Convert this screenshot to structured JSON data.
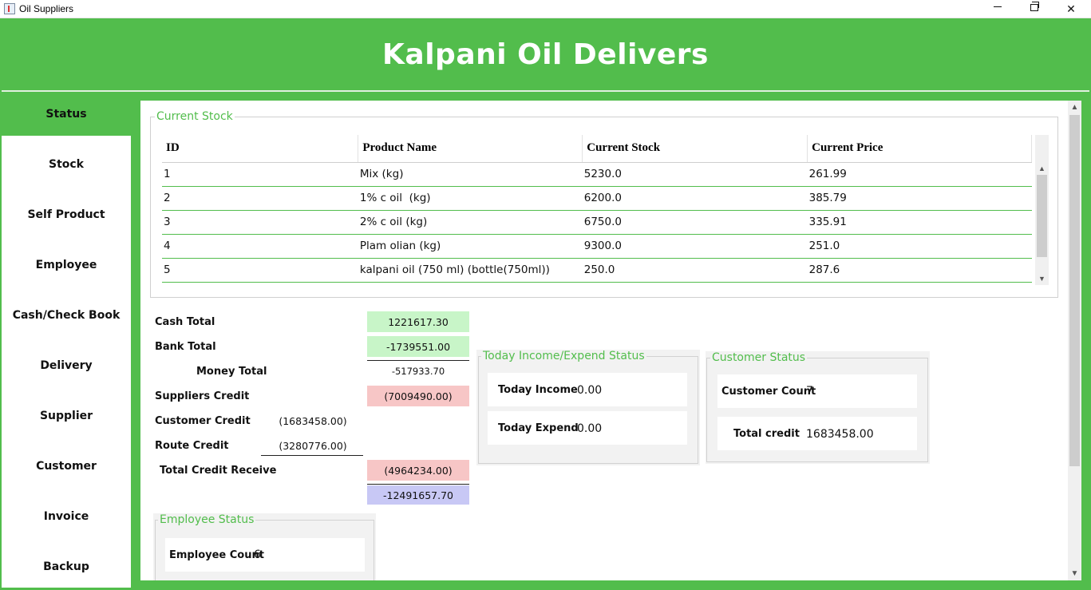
{
  "window": {
    "title": "Oil Suppliers"
  },
  "header": {
    "title": "Kalpani Oil Delivers"
  },
  "sidebar": {
    "items": [
      {
        "label": "Status"
      },
      {
        "label": "Stock"
      },
      {
        "label": "Self Product"
      },
      {
        "label": "Employee"
      },
      {
        "label": "Cash/Check Book"
      },
      {
        "label": "Delivery"
      },
      {
        "label": "Supplier"
      },
      {
        "label": "Customer"
      },
      {
        "label": "Invoice"
      },
      {
        "label": "Backup"
      }
    ],
    "active": "Status"
  },
  "stock": {
    "title": "Current Stock",
    "columns": [
      "ID",
      "Product Name",
      "Current Stock",
      "Current Price"
    ],
    "rows": [
      [
        "1",
        "Mix (kg)",
        "5230.0",
        "261.99"
      ],
      [
        "2",
        "1% c oil  (kg)",
        "6200.0",
        "385.79"
      ],
      [
        "3",
        "2% c oil (kg)",
        "6750.0",
        "335.91"
      ],
      [
        "4",
        "Plam olian (kg)",
        "9300.0",
        "251.0"
      ],
      [
        "5",
        "kalpani oil (750 ml) (bottle(750ml))",
        "250.0",
        "287.6"
      ]
    ]
  },
  "finance": {
    "cash_total_label": "Cash Total",
    "cash_total": "1221617.30",
    "bank_total_label": "Bank Total",
    "bank_total": "-1739551.00",
    "money_total_label": "Money Total",
    "money_total": "-517933.70",
    "suppliers_credit_label": "Suppliers Credit",
    "suppliers_credit": "(7009490.00)",
    "customer_credit_label": "Customer Credit",
    "customer_credit": "(1683458.00)",
    "route_credit_label": "Route Credit",
    "route_credit": "(3280776.00)",
    "total_credit_receive_label": "Total Credit Receive",
    "total_credit_receive": "(4964234.00)",
    "grand_total": "-12491657.70"
  },
  "today": {
    "title": "Today Income/Expend Status",
    "income_label": "Today Income",
    "income": "0.00",
    "expend_label": "Today Expend",
    "expend": "0.00"
  },
  "customer_status": {
    "title": "Customer Status",
    "count_label": "Customer Count",
    "count": "7",
    "credit_label": "Total credit",
    "credit": "1683458.00"
  },
  "employee_status": {
    "title": "Employee Status",
    "count_label": "Employee Count",
    "count": "6"
  },
  "colors": {
    "accent": "#52bd4c",
    "positive": "#c8f5c8",
    "negative": "#f7c6c6",
    "total": "#c8c8f5"
  }
}
